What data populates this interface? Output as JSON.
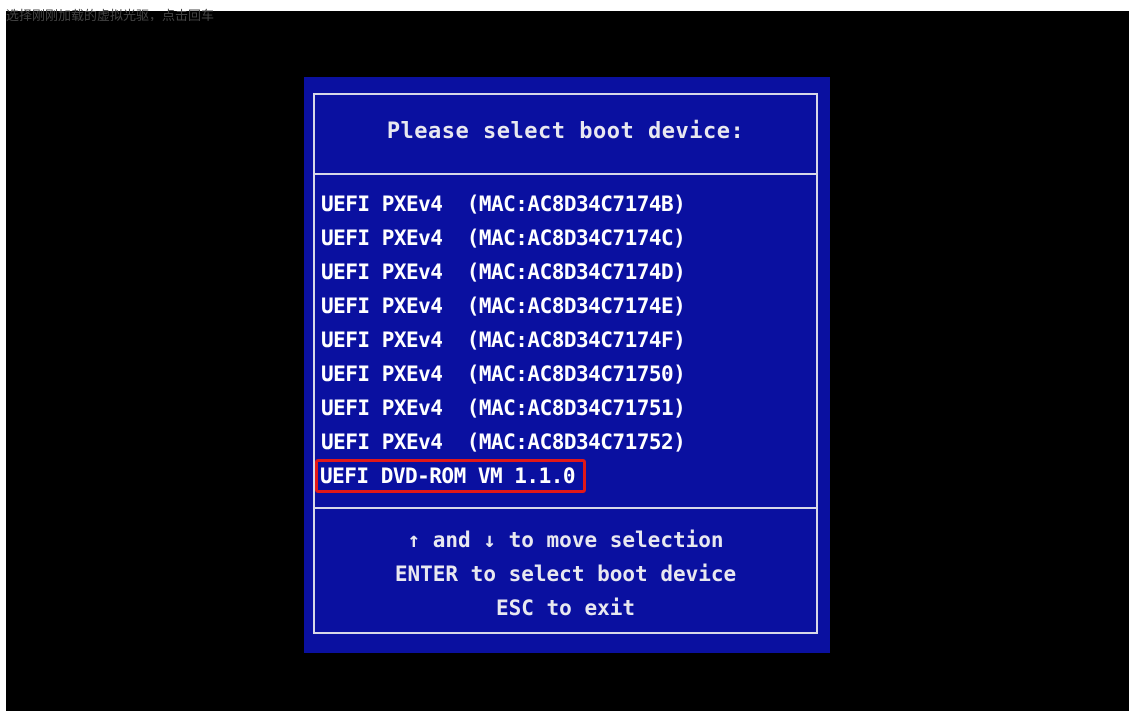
{
  "caption": "选择刚刚加载的虚拟光驱，点击回车",
  "dialog": {
    "title": "Please select boot device:",
    "devices": [
      {
        "label": "UEFI PXEv4  (MAC:AC8D34C7174B)",
        "selected": false
      },
      {
        "label": "UEFI PXEv4  (MAC:AC8D34C7174C)",
        "selected": false
      },
      {
        "label": "UEFI PXEv4  (MAC:AC8D34C7174D)",
        "selected": false
      },
      {
        "label": "UEFI PXEv4  (MAC:AC8D34C7174E)",
        "selected": false
      },
      {
        "label": "UEFI PXEv4  (MAC:AC8D34C7174F)",
        "selected": false
      },
      {
        "label": "UEFI PXEv4  (MAC:AC8D34C71750)",
        "selected": false
      },
      {
        "label": "UEFI PXEv4  (MAC:AC8D34C71751)",
        "selected": false
      },
      {
        "label": "UEFI PXEv4  (MAC:AC8D34C71752)",
        "selected": false
      },
      {
        "label": "UEFI DVD-ROM VM 1.1.0",
        "selected": true
      }
    ],
    "help": [
      "↑ and ↓ to move selection",
      "ENTER to select boot device",
      "ESC to exit"
    ]
  },
  "colors": {
    "screen_bg": "#000000",
    "panel_bg": "#0a10a0",
    "text": "#ffffff",
    "highlight_border": "#e21818"
  }
}
